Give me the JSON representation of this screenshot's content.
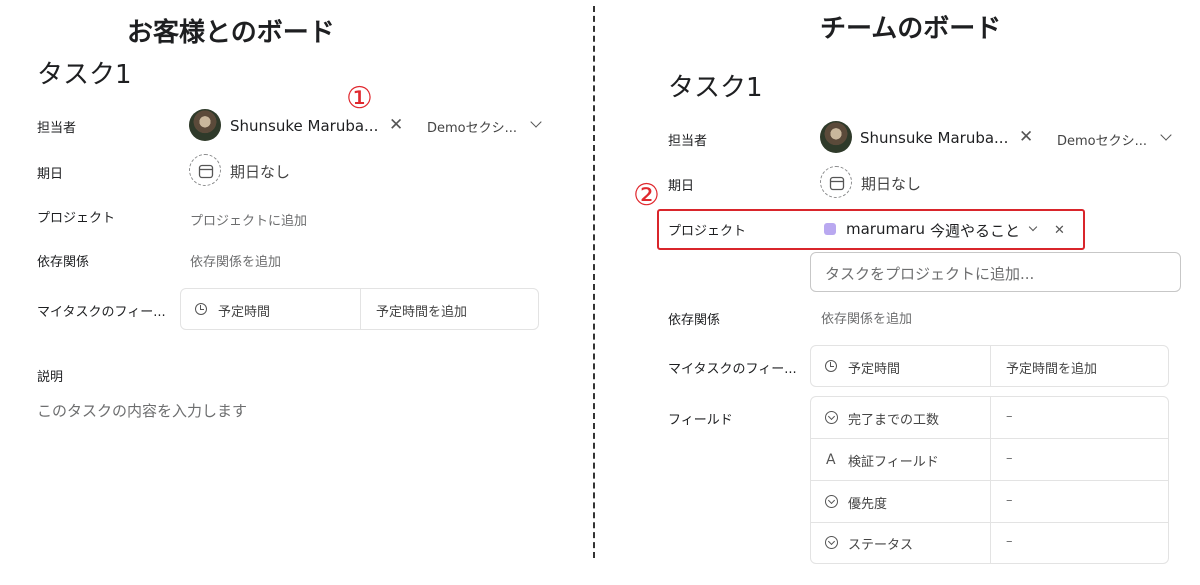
{
  "left": {
    "heading": "お客様とのボード",
    "task_title": "タスク1",
    "assignee_label": "担当者",
    "assignee_name": "Shunsuke Maruba...",
    "section_name": "Demoセクシ...",
    "due_label": "期日",
    "due_value": "期日なし",
    "project_label": "プロジェクト",
    "project_value": "プロジェクトに追加",
    "dependency_label": "依存関係",
    "dependency_value": "依存関係を追加",
    "mytask_label": "マイタスクのフィー...",
    "estimate_label": "予定時間",
    "estimate_value": "予定時間を追加",
    "description_label": "説明",
    "description_placeholder": "このタスクの内容を入力します",
    "marker": "①"
  },
  "right": {
    "heading": "チームのボード",
    "task_title": "タスク1",
    "assignee_label": "担当者",
    "assignee_name": "Shunsuke Maruba...",
    "section_name": "Demoセクシ...",
    "due_label": "期日",
    "due_value": "期日なし",
    "project_label": "プロジェクト",
    "project_name": "marumaru",
    "project_section": "今週やること",
    "add_project_placeholder": "タスクをプロジェクトに追加...",
    "dependency_label": "依存関係",
    "dependency_value": "依存関係を追加",
    "mytask_label": "マイタスクのフィー...",
    "estimate_label": "予定時間",
    "estimate_value": "予定時間を追加",
    "fields_label": "フィールド",
    "fields": [
      {
        "name": "完了までの工数",
        "value": "–",
        "icon": "circle-chevron-icon"
      },
      {
        "name": "検証フィールド",
        "value": "–",
        "icon": "text-a-icon"
      },
      {
        "name": "優先度",
        "value": "–",
        "icon": "circle-chevron-icon"
      },
      {
        "name": "ステータス",
        "value": "–",
        "icon": "circle-chevron-icon"
      }
    ],
    "marker": "②",
    "highlight_color": "#d9252b"
  }
}
